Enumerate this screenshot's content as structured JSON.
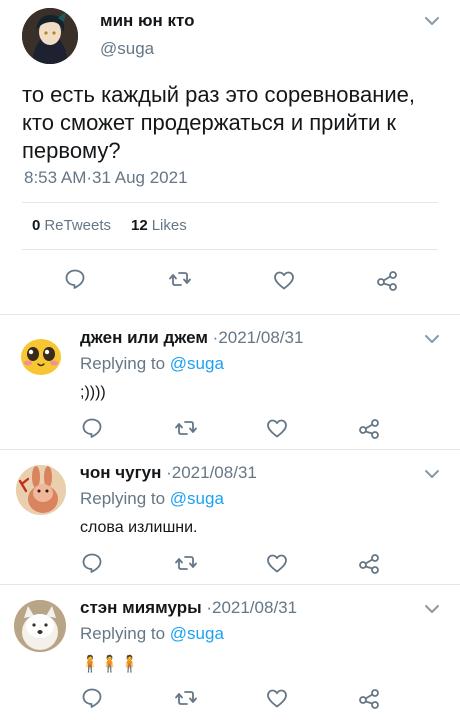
{
  "tweet": {
    "author_name": "мин юн кто",
    "author_handle": "@suga",
    "text": "то есть каждый раз это соревнование, кто сможет продержаться и прийти к первому?",
    "timestamp": "8:53 AM·31 Aug 2021",
    "retweets_count": "0",
    "retweets_label": "ReTweets",
    "likes_count": "12",
    "likes_label": "Likes"
  },
  "replies": [
    {
      "name": "джен или джем",
      "date": "·2021/08/31",
      "replying_prefix": "Replying to",
      "replying_handle": "@suga",
      "text": ";))))"
    },
    {
      "name": "чон чугун",
      "date": "·2021/08/31",
      "replying_prefix": "Replying to",
      "replying_handle": "@suga",
      "text": "слова излишни."
    },
    {
      "name": "стэн миямуры",
      "date": "·2021/08/31",
      "replying_prefix": "Replying to",
      "replying_handle": "@suga",
      "text": "🧍🧍🧍"
    }
  ],
  "icons": {
    "reply": "reply-icon",
    "retweet": "retweet-icon",
    "like": "heart-icon",
    "share": "share-icon",
    "more": "chevron-down-icon"
  },
  "colors": {
    "link": "#1da1f2",
    "secondary_text": "#657786",
    "divider": "#e1e8ed",
    "icon": "#657786"
  }
}
